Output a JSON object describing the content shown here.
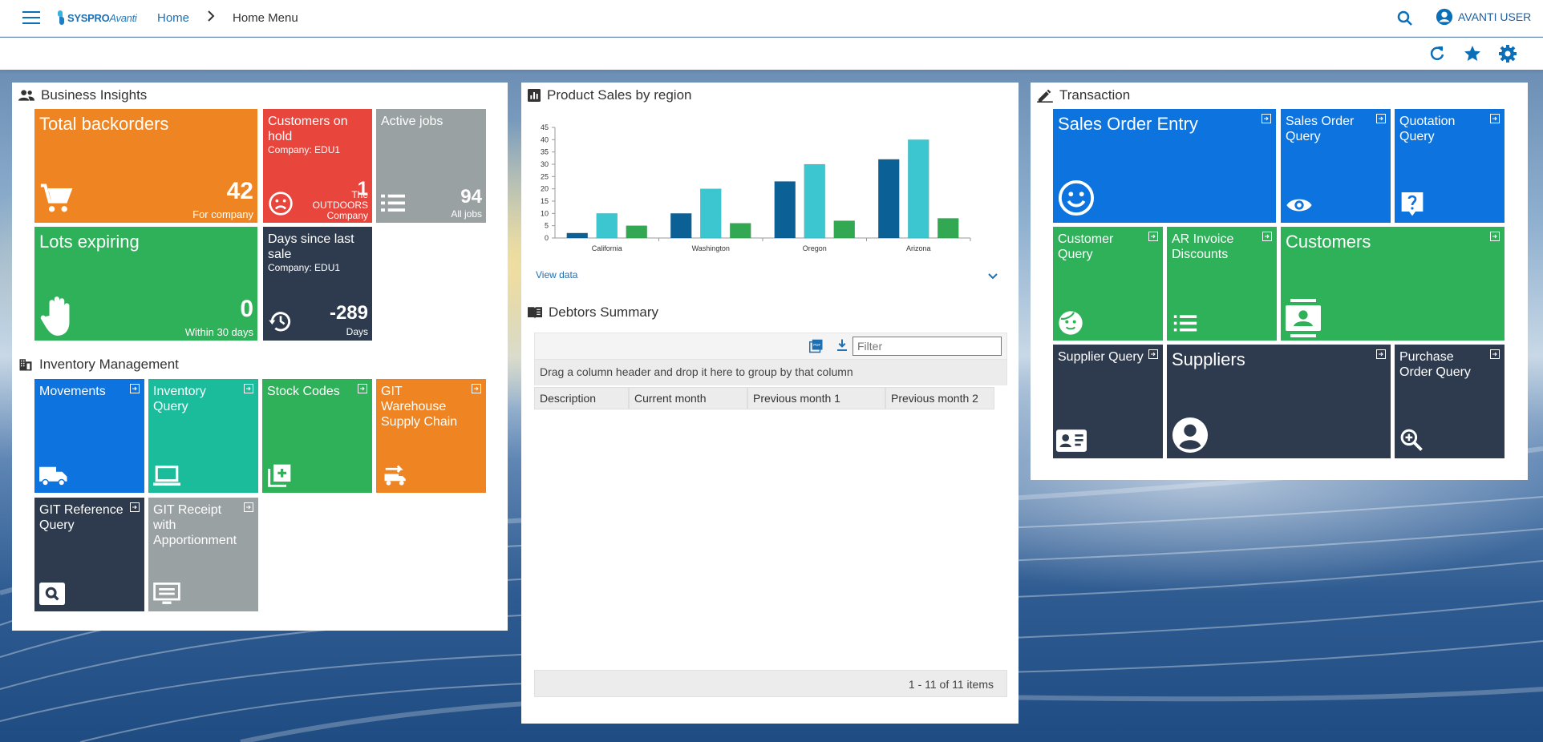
{
  "header": {
    "logo_text": "SYSPRO",
    "logo_sub": "Avanti",
    "breadcrumb": {
      "home": "Home",
      "separator": "›",
      "current": "Home Menu"
    },
    "user_name": "AVANTI USER",
    "colors": {
      "accent": "#0b6fb8",
      "link": "#1f6fb0"
    }
  },
  "business_insights": {
    "title": "Business Insights",
    "tiles": [
      {
        "title": "Total backorders",
        "value": "42",
        "caption": "For company",
        "icon": "cart-icon",
        "color": "#ef8522"
      },
      {
        "title": "Customers on hold",
        "subtitle": "Company: EDU1",
        "value": "1",
        "caption": "The OUTDOORS Company",
        "icon": "sad-face-icon",
        "color": "#e8453c"
      },
      {
        "title": "Active jobs",
        "value": "94",
        "caption": "All jobs",
        "icon": "list-icon",
        "color": "#9aa1a3"
      },
      {
        "title": "Lots expiring",
        "value": "0",
        "caption": "Within 30 days",
        "icon": "hand-icon",
        "color": "#2fb15a"
      },
      {
        "title": "Days since last sale",
        "subtitle": "Company: EDU1",
        "value": "-289",
        "caption": "Days",
        "icon": "history-icon",
        "color": "#2e3b4e"
      }
    ]
  },
  "inventory": {
    "title": "Inventory Management",
    "tiles": [
      {
        "title": "Movements",
        "icon": "truck-icon",
        "color": "#0d73df"
      },
      {
        "title": "Inventory Query",
        "icon": "laptop-icon",
        "color": "#1bbc9b"
      },
      {
        "title": "Stock Codes",
        "icon": "add-box-icon",
        "color": "#2fb15a"
      },
      {
        "title": "GIT Warehouse Supply Chain",
        "icon": "transfer-icon",
        "color": "#ef8522"
      },
      {
        "title": "GIT Reference Query",
        "icon": "search-box-icon",
        "color": "#2e3b4e"
      },
      {
        "title": "GIT Receipt with Apportionment",
        "icon": "subtitles-icon",
        "color": "#9aa1a3"
      }
    ]
  },
  "product_sales": {
    "title": "Product Sales by region",
    "view_data": "View data"
  },
  "chart_data": {
    "type": "bar",
    "categories": [
      "California",
      "Washington",
      "Oregon",
      "Arizona"
    ],
    "series": [
      {
        "values": [
          2,
          10,
          23,
          32
        ],
        "color": "#0b6096"
      },
      {
        "values": [
          10,
          20,
          30,
          40
        ],
        "color": "#3cc6d0"
      },
      {
        "values": [
          5,
          6,
          7,
          8
        ],
        "color": "#32a853"
      }
    ],
    "yticks": [
      0,
      5,
      10,
      15,
      20,
      25,
      30,
      35,
      40,
      45
    ],
    "ylim": [
      0,
      45
    ],
    "grid": false
  },
  "debtors": {
    "title": "Debtors Summary",
    "filter_placeholder": "Filter",
    "group_hint": "Drag a column header and drop it here to group by that column",
    "columns": [
      "Description",
      "Current month",
      "Previous month 1",
      "Previous month 2"
    ],
    "pager": "1 - 11 of 11 items"
  },
  "transaction": {
    "title": "Transaction",
    "tiles": [
      {
        "title": "Sales Order Entry",
        "icon": "smiley-icon",
        "color": "#0d73df"
      },
      {
        "title": "Sales Order Query",
        "icon": "eye-icon",
        "color": "#0d73df"
      },
      {
        "title": "Quotation Query",
        "icon": "help-box-icon",
        "color": "#0d73df"
      },
      {
        "title": "Customer Query",
        "icon": "face-icon",
        "color": "#2fb15a"
      },
      {
        "title": "AR Invoice Discounts",
        "icon": "list-icon",
        "color": "#2fb15a"
      },
      {
        "title": "Customers",
        "icon": "contact-card-icon",
        "color": "#2fb15a"
      },
      {
        "title": "Supplier Query",
        "icon": "contact-mail-icon",
        "color": "#2e3b4e"
      },
      {
        "title": "Suppliers",
        "icon": "account-circle-icon",
        "color": "#2e3b4e"
      },
      {
        "title": "Purchase Order Query",
        "icon": "zoom-in-icon",
        "color": "#2e3b4e"
      }
    ]
  }
}
